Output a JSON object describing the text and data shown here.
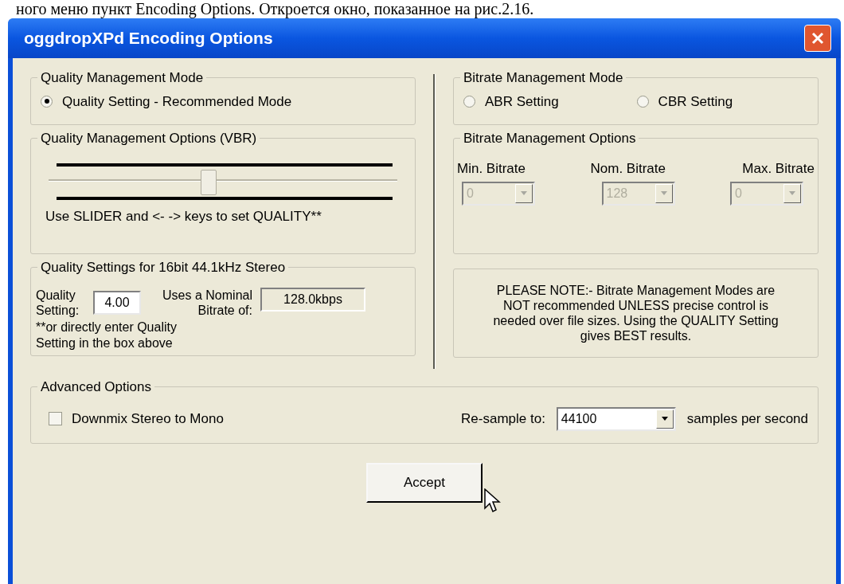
{
  "caption": "ного меню пункт Encoding Options. Откроется окно, показанное на рис.2.16.",
  "window": {
    "title": "oggdropXPd Encoding Options"
  },
  "quality_mode": {
    "title": "Quality Management Mode",
    "options": [
      {
        "label": "Quality Setting - Recommended Mode",
        "selected": true
      }
    ]
  },
  "bitrate_mode": {
    "title": "Bitrate Management Mode",
    "options": [
      {
        "label": "ABR Setting",
        "selected": false
      },
      {
        "label": "CBR Setting",
        "selected": false
      }
    ]
  },
  "quality_options": {
    "title": "Quality Management Options (VBR)",
    "slider": {
      "level": 0.46
    },
    "hint": "Use SLIDER and <- -> keys to set QUALITY**"
  },
  "bitrate_options": {
    "title": "Bitrate Management Options",
    "fields": [
      {
        "label": "Min. Bitrate",
        "value": "0",
        "disabled": true
      },
      {
        "label": "Nom. Bitrate",
        "value": "128",
        "disabled": true
      },
      {
        "label": "Max. Bitrate",
        "value": "0",
        "disabled": true
      }
    ]
  },
  "quality_settings": {
    "title": "Quality Settings for 16bit 44.1kHz Stereo",
    "quality_label": "Quality Setting:",
    "quality_value": "4.00",
    "bitrate_label": "Uses a Nominal Bitrate of:",
    "bitrate_value": "128.0kbps",
    "note": "**or directly enter Quality Setting in the box above"
  },
  "note": "PLEASE NOTE:- Bitrate Management Modes are NOT recommended UNLESS precise control is needed over file sizes. Using the QUALITY Setting gives BEST results.",
  "advanced": {
    "title": "Advanced Options",
    "downmix": {
      "label": "Downmix Stereo to Mono",
      "checked": false
    },
    "resample_label": "Re-sample to:",
    "resample_value": "44100",
    "resample_suffix": "samples per second"
  },
  "buttons": [
    "Accept"
  ]
}
